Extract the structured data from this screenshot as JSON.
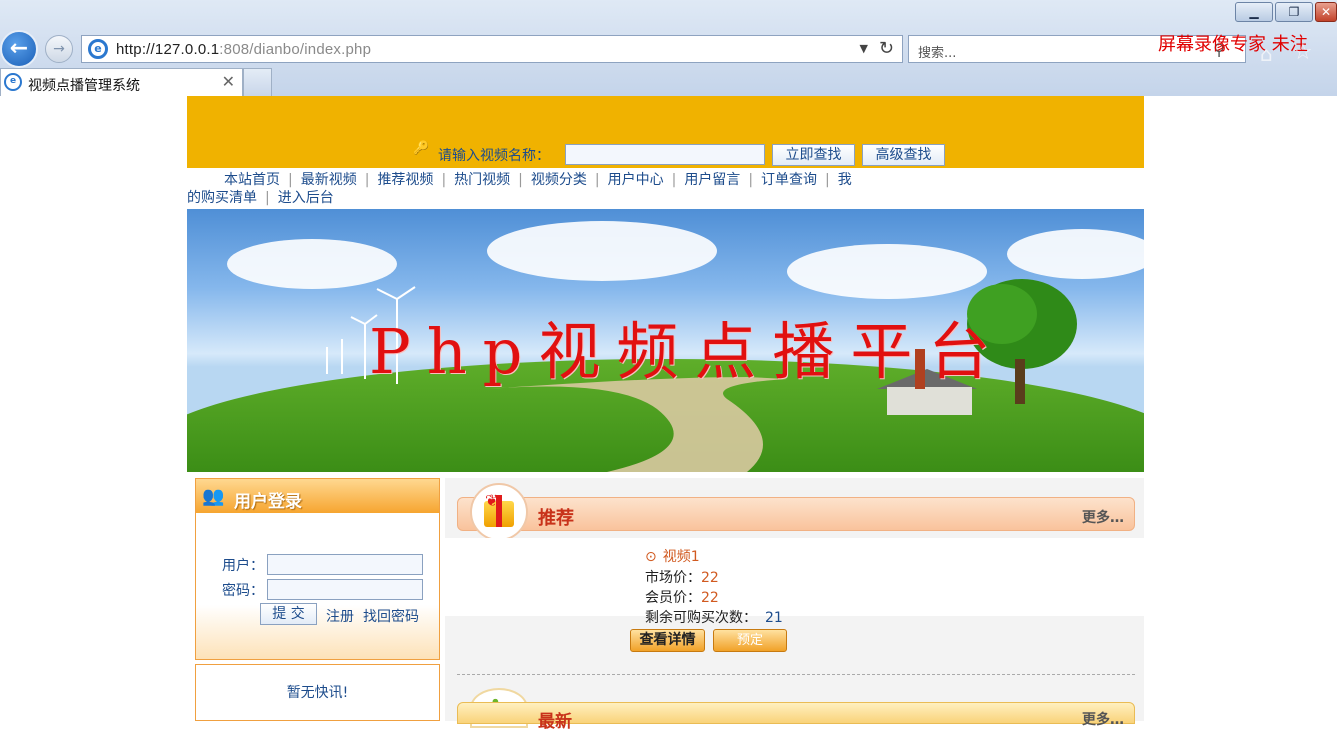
{
  "browser": {
    "url_host": "http://127.0.0.1",
    "url_path": ":808/dianbo/index.php",
    "search_placeholder": "搜索...",
    "tab_title": "视频点播管理系统",
    "watermark": "屏幕录像专家 未注"
  },
  "site": {
    "search_label": "请输入视频名称：",
    "search_button": "立即查找",
    "advanced_button": "高级查找",
    "nav": [
      "本站首页",
      "最新视频",
      "推荐视频",
      "热门视频",
      "视频分类",
      "用户中心",
      "用户留言",
      "订单查询",
      "我的购买清单",
      "进入后台"
    ],
    "banner_title": "Php视频点播平台"
  },
  "login": {
    "title": "用户登录",
    "user_label": "用户：",
    "pass_label": "密码：",
    "submit": "提 交",
    "register": "注册",
    "forgot": "找回密码"
  },
  "news": {
    "empty": "暂无快讯!"
  },
  "recommend": {
    "title": "推荐",
    "more": "更多…",
    "video": {
      "name": "视频1",
      "market_label": "市场价：",
      "market_price": "22",
      "member_label": "会员价：",
      "member_price": "22",
      "remain_label": "剩余可购买次数：",
      "remain": "21"
    },
    "detail_button": "查看详情",
    "book_button": "预定"
  },
  "latest": {
    "title": "最新",
    "more": "更多…"
  },
  "colors": {
    "header": "#f0b200",
    "link": "#1d4c8c",
    "price": "#d15a20",
    "watermark": "#e00000"
  }
}
